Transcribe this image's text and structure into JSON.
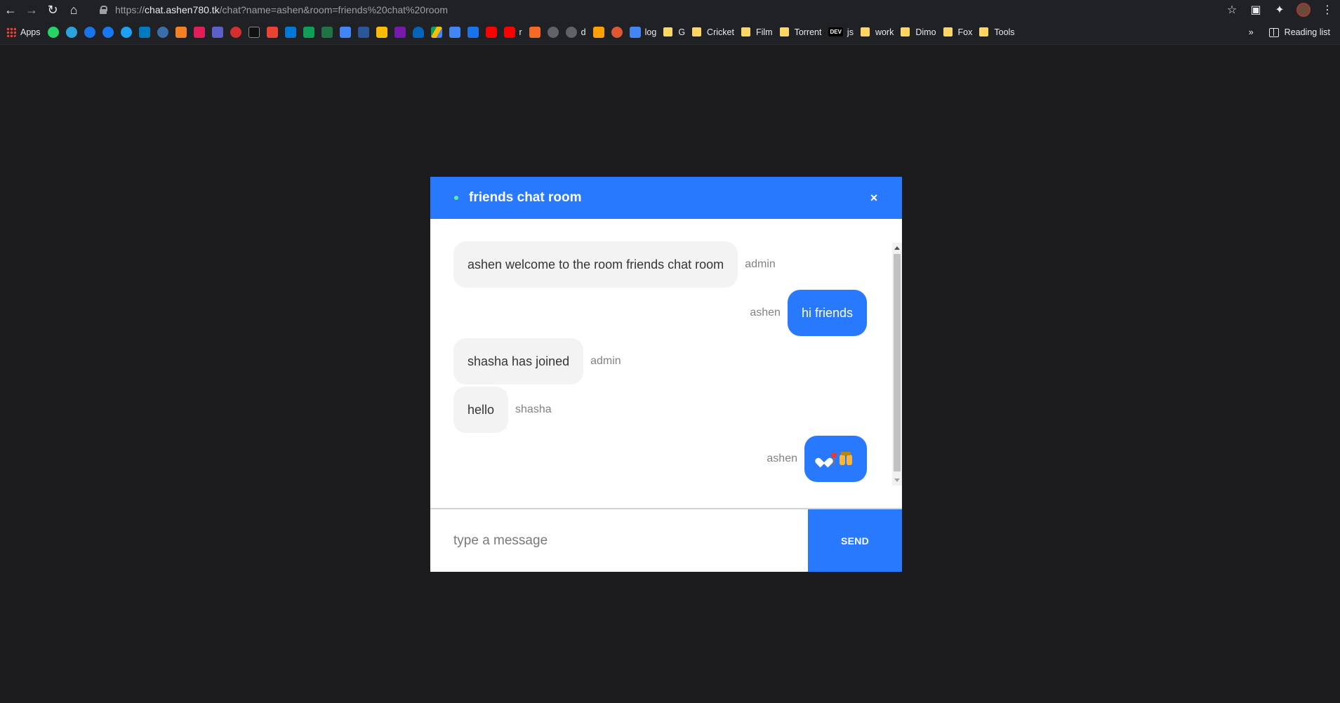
{
  "browser": {
    "url_scheme": "https://",
    "url_host": "chat.ashen780.tk",
    "url_path": "/chat?name=ashen&room=friends%20chat%20room",
    "apps_label": "Apps",
    "bookmarks": [
      {
        "label": "log",
        "icon": "docs-icon",
        "color": "#4285f4"
      },
      {
        "label": "G",
        "icon": "folder-icon",
        "color": "#fdd663"
      },
      {
        "label": "Cricket",
        "icon": "folder-icon",
        "color": "#fdd663"
      },
      {
        "label": "Film",
        "icon": "folder-icon",
        "color": "#fdd663"
      },
      {
        "label": "Torrent",
        "icon": "folder-icon",
        "color": "#fdd663"
      },
      {
        "label": "js",
        "icon": "dev-icon",
        "color": "#000000"
      },
      {
        "label": "work",
        "icon": "folder-icon",
        "color": "#fdd663"
      },
      {
        "label": "Dimo",
        "icon": "folder-icon",
        "color": "#fdd663"
      },
      {
        "label": "Fox",
        "icon": "folder-icon",
        "color": "#fdd663"
      },
      {
        "label": "Tools",
        "icon": "folder-icon",
        "color": "#fdd663"
      }
    ],
    "short_labels": {
      "r": "r",
      "d": "d",
      "dev": "DEV"
    },
    "overflow_label": "»",
    "reading_list_label": "Reading list"
  },
  "chat": {
    "room_title": "friends chat room",
    "close_label": "×",
    "accent_color": "#2979ff",
    "messages": [
      {
        "text": "ashen welcome to the room friends chat room",
        "sender": "admin",
        "side": "left"
      },
      {
        "text": "hi friends",
        "sender": "ashen",
        "side": "right"
      },
      {
        "text": "shasha has joined",
        "sender": "admin",
        "side": "left"
      },
      {
        "text": "hello",
        "sender": "shasha",
        "side": "left"
      },
      {
        "text": "",
        "emoji": [
          "white-heart-icon",
          "round-pushpin-icon",
          "raising-hands-icon"
        ],
        "sender": "ashen",
        "side": "right"
      }
    ],
    "input": {
      "placeholder": "type a message",
      "value": ""
    },
    "send_label": "SEND"
  }
}
